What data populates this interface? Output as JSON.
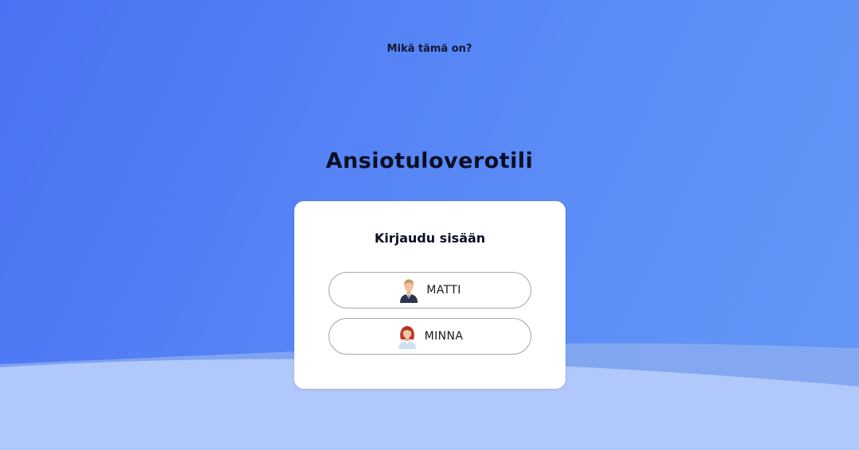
{
  "header": {
    "help_link": "Mikä tämä on?"
  },
  "app": {
    "title": "Ansiotuloverotili"
  },
  "login_card": {
    "title": "Kirjaudu sisään",
    "users": [
      {
        "label": "MATTI",
        "icon": "male-avatar-icon"
      },
      {
        "label": "MINNA",
        "icon": "female-avatar-icon"
      }
    ]
  },
  "colors": {
    "background_start": "#4b72f4",
    "background_end": "#6498f7",
    "wave_light": "#afc6f9",
    "card": "#ffffff",
    "text_dark": "#0b0f22"
  }
}
